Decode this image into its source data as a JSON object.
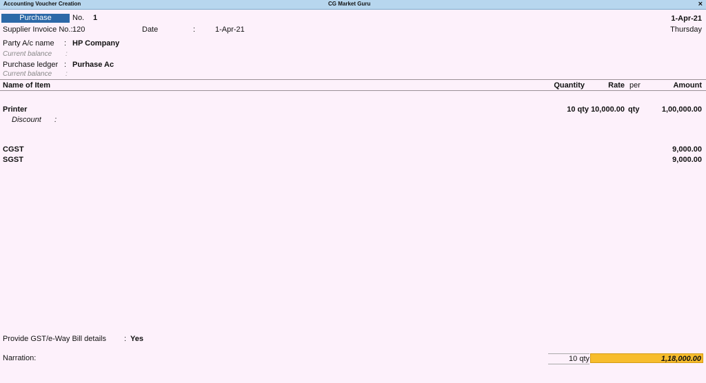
{
  "window": {
    "title_left": "Accounting Voucher Creation",
    "title_center": "CG Market Guru",
    "close": "×"
  },
  "voucher": {
    "type": "Purchase",
    "no_label": "No.",
    "no_value": "1",
    "date_display": "1-Apr-21",
    "day": "Thursday"
  },
  "header": {
    "supplier_invoice_label": "Supplier Invoice No.:",
    "supplier_invoice_value": "120",
    "date_label": "Date",
    "date_colon": ":",
    "date_value": "1-Apr-21",
    "party_label": "Party A/c name",
    "party_value": "HP Company",
    "current_balance_label": "Current balance",
    "purchase_ledger_label": "Purchase ledger",
    "purchase_ledger_value": "Purhase Ac",
    "colon": ":"
  },
  "table": {
    "col_item": "Name of Item",
    "col_qty": "Quantity",
    "col_rate": "Rate",
    "col_per": "per",
    "col_amount": "Amount",
    "item": {
      "name": "Printer",
      "qty": "10 qty",
      "rate": "10,000.00",
      "per": "qty",
      "amount": "1,00,000.00",
      "discount_label": "Discount",
      "discount_colon": ":"
    },
    "taxes": [
      {
        "name": "CGST",
        "amount": "9,000.00"
      },
      {
        "name": "SGST",
        "amount": "9,000.00"
      }
    ]
  },
  "footer": {
    "gst_label": "Provide GST/e-Way Bill details",
    "gst_colon": ":",
    "gst_value": "Yes",
    "narration_label": "Narration:",
    "total_qty": "10 qty",
    "total_amount": "1,18,000.00"
  }
}
